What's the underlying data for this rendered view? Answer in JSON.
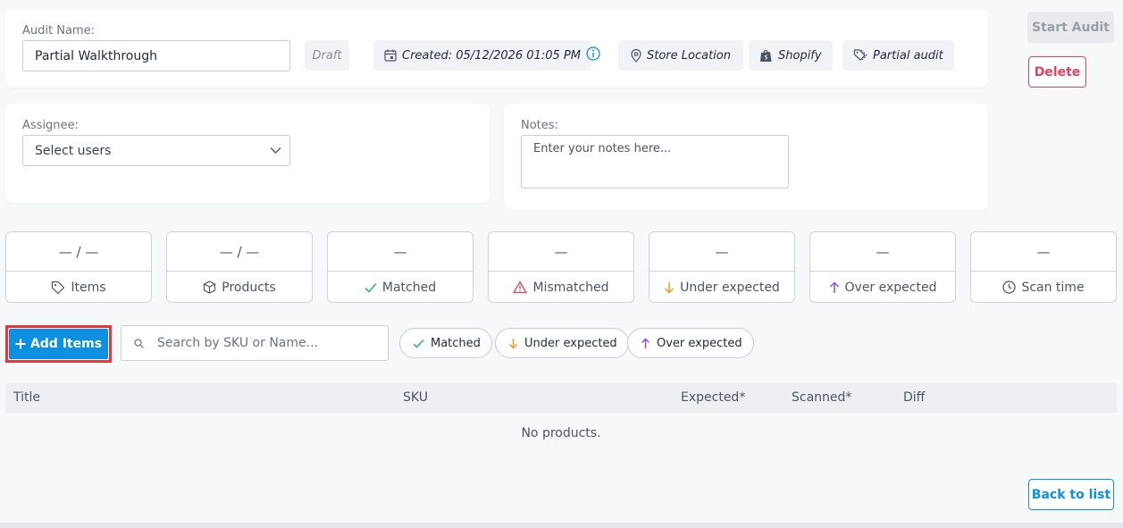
{
  "audit": {
    "name_label": "Audit Name:",
    "name_value": "Partial Walkthrough",
    "status": "Draft",
    "created": "Created: 05/12/2026 01:05 PM",
    "location": "Store Location",
    "source": "Shopify",
    "type": "Partial audit"
  },
  "actions": {
    "start_audit": "Start Audit",
    "delete": "Delete",
    "back_to_list": "Back to list",
    "add_items": "Add Items"
  },
  "assignee": {
    "label": "Assignee:",
    "placeholder": "Select users"
  },
  "notes": {
    "label": "Notes:",
    "placeholder": "Enter your notes here..."
  },
  "stats": [
    {
      "value": "— / —",
      "label": "Items",
      "icon": "tag-icon"
    },
    {
      "value": "— / —",
      "label": "Products",
      "icon": "box-icon"
    },
    {
      "value": "—",
      "label": "Matched",
      "icon": "check-icon"
    },
    {
      "value": "—",
      "label": "Mismatched",
      "icon": "warning-icon"
    },
    {
      "value": "—",
      "label": "Under expected",
      "icon": "arrow-down-icon"
    },
    {
      "value": "—",
      "label": "Over expected",
      "icon": "arrow-up-icon"
    },
    {
      "value": "—",
      "label": "Scan time",
      "icon": "clock-icon"
    }
  ],
  "search": {
    "placeholder": "Search by SKU or Name..."
  },
  "filters": {
    "matched": "Matched",
    "under_expected": "Under expected",
    "over_expected": "Over expected"
  },
  "table": {
    "columns": [
      "Title",
      "SKU",
      "Expected*",
      "Scanned*",
      "Diff"
    ],
    "empty_message": "No products."
  },
  "colors": {
    "primary": "#0e90e0",
    "danger": "#e0435f",
    "success": "#2fb37a",
    "warning": "#f29a1f",
    "purple": "#8a4af0",
    "highlight": "#e53935"
  }
}
